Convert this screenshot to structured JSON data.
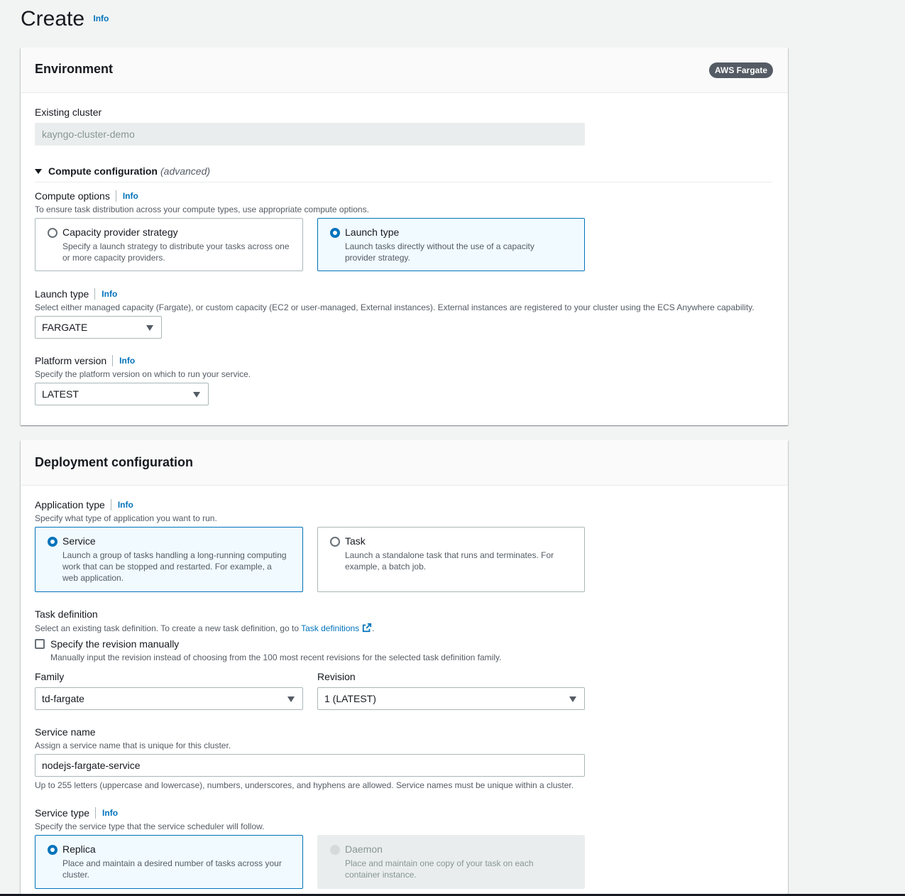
{
  "page": {
    "title": "Create",
    "info": "Info"
  },
  "environment": {
    "title": "Environment",
    "badge": "AWS Fargate",
    "existing_cluster": {
      "label": "Existing cluster",
      "value": "kayngo-cluster-demo"
    },
    "compute_config": {
      "label": "Compute configuration",
      "suffix": "(advanced)"
    },
    "compute_options": {
      "label": "Compute options",
      "info": "Info",
      "description": "To ensure task distribution across your compute types, use appropriate compute options.",
      "tiles": [
        {
          "title": "Capacity provider strategy",
          "desc": "Specify a launch strategy to distribute your tasks across one or more capacity providers.",
          "selected": false
        },
        {
          "title": "Launch type",
          "desc": "Launch tasks directly without the use of a capacity provider strategy.",
          "selected": true
        }
      ]
    },
    "launch_type": {
      "label": "Launch type",
      "info": "Info",
      "description": "Select either managed capacity (Fargate), or custom capacity (EC2 or user-managed, External instances). External instances are registered to your cluster using the ECS Anywhere capability.",
      "value": "FARGATE"
    },
    "platform_version": {
      "label": "Platform version",
      "info": "Info",
      "description": "Specify the platform version on which to run your service.",
      "value": "LATEST"
    }
  },
  "deployment": {
    "title": "Deployment configuration",
    "application_type": {
      "label": "Application type",
      "info": "Info",
      "description": "Specify what type of application you want to run.",
      "tiles": [
        {
          "title": "Service",
          "desc": "Launch a group of tasks handling a long-running computing work that can be stopped and restarted. For example, a web application.",
          "selected": true
        },
        {
          "title": "Task",
          "desc": "Launch a standalone task that runs and terminates. For example, a batch job.",
          "selected": false
        }
      ]
    },
    "task_definition": {
      "label": "Task definition",
      "description_prefix": "Select an existing task definition. To create a new task definition, go to",
      "link": "Task definitions",
      "description_suffix": ".",
      "checkbox_label": "Specify the revision manually",
      "checkbox_desc": "Manually input the revision instead of choosing from the 100 most recent revisions for the selected task definition family.",
      "family_label": "Family",
      "family_value": "td-fargate",
      "revision_label": "Revision",
      "revision_value": "1 (LATEST)"
    },
    "service_name": {
      "label": "Service name",
      "description": "Assign a service name that is unique for this cluster.",
      "value": "nodejs-fargate-service",
      "constraint": "Up to 255 letters (uppercase and lowercase), numbers, underscores, and hyphens are allowed. Service names must be unique within a cluster."
    },
    "service_type": {
      "label": "Service type",
      "info": "Info",
      "description": "Specify the service type that the service scheduler will follow.",
      "tiles": [
        {
          "title": "Replica",
          "desc": "Place and maintain a desired number of tasks across your cluster.",
          "selected": true
        },
        {
          "title": "Daemon",
          "desc": "Place and maintain one copy of your task on each container instance.",
          "selected": false,
          "disabled": true
        }
      ]
    }
  },
  "colors": {
    "accent": "#0073bb",
    "selected_bg": "#f1faff",
    "badge_bg": "#545b64"
  }
}
